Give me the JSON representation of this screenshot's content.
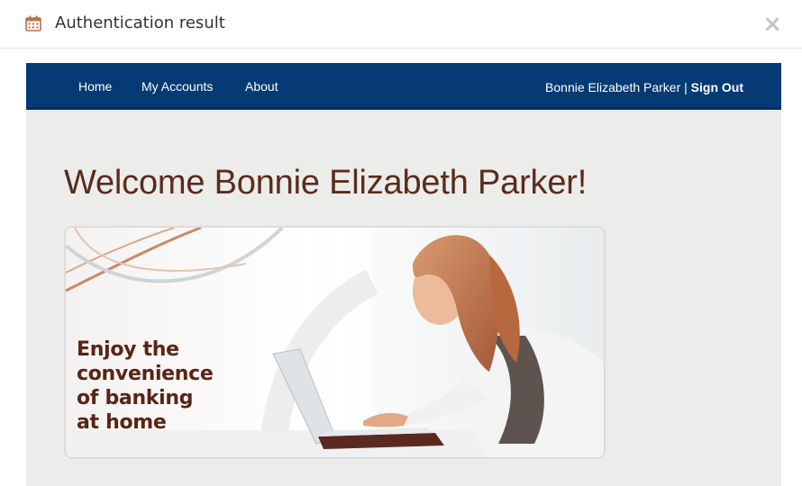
{
  "modal": {
    "title": "Authentication result",
    "title_icon": "calendar-icon",
    "close_label": "×"
  },
  "navbar": {
    "links": [
      "Home",
      "My Accounts",
      "About"
    ],
    "user_name": "Bonnie Elizabeth Parker",
    "separator": "|",
    "sign_out": "Sign Out"
  },
  "page": {
    "welcome": "Welcome Bonnie Elizabeth Parker!"
  },
  "banner": {
    "lines": [
      "Enjoy the",
      "convenience",
      "of banking",
      "at home"
    ]
  },
  "colors": {
    "navbar_bg": "#063a74",
    "welcome_text": "#5a2c1c",
    "banner_text": "#5a2414",
    "page_bg": "#ececea"
  }
}
